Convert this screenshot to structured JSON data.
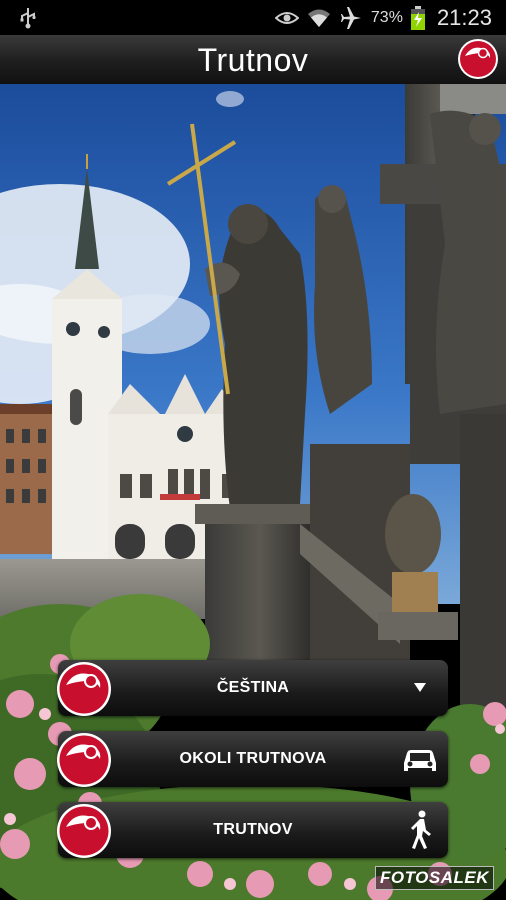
{
  "status_bar": {
    "battery_percent": "73%",
    "time": "21:23",
    "icons": [
      "usb-icon",
      "eye-icon",
      "wifi-icon",
      "airplane-mode-icon",
      "battery-charging-icon"
    ]
  },
  "action_bar": {
    "title": "Trutnov",
    "logo_icon": "app-logo-icon"
  },
  "menu": {
    "items": [
      {
        "label": "ČEŠTINA",
        "trailing_icon": "dropdown-arrow-icon"
      },
      {
        "label": "OKOLI TRUTNOVA",
        "trailing_icon": "car-icon"
      },
      {
        "label": "TRUTNOV",
        "trailing_icon": "walking-person-icon"
      }
    ]
  },
  "watermark": "FOTOSALEK",
  "colors": {
    "brand_red": "#c8102e",
    "action_bar": "#1e1e1e",
    "button": "#222222"
  }
}
